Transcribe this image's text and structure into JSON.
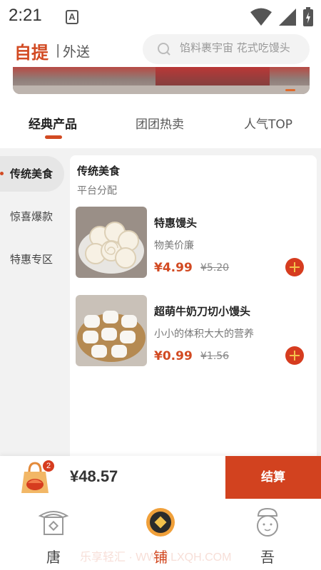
{
  "status_bar": {
    "time": "2:21",
    "notification_glyph": "A"
  },
  "header": {
    "mode_pickup": "自提",
    "mode_separator": "|",
    "mode_delivery": "外送",
    "search_placeholder": "馅料裹宇宙 花式吃馒头"
  },
  "tabs": [
    {
      "label": "经典产品",
      "active": true
    },
    {
      "label": "团团热卖",
      "active": false
    },
    {
      "label": "人气TOP",
      "active": false
    }
  ],
  "sidebar": {
    "items": [
      {
        "label": "传统美食",
        "active": true
      },
      {
        "label": "惊喜爆款",
        "active": false
      },
      {
        "label": "特惠专区",
        "active": false
      }
    ]
  },
  "category": {
    "title": "传统美食",
    "subtitle": "平台分配"
  },
  "products": [
    {
      "name": "特惠馒头",
      "desc": "物美价廉",
      "price": "¥4.99",
      "old_price": "¥5.20"
    },
    {
      "name": "超萌牛奶刀切小馒头",
      "desc": "小小的体积大大的营养",
      "price": "¥0.99",
      "old_price": "¥1.56"
    }
  ],
  "cart": {
    "badge": "2",
    "total": "¥48.57",
    "checkout_label": "结算"
  },
  "bottom_nav": [
    {
      "label": "唐",
      "icon": "pagoda-icon",
      "active": false
    },
    {
      "label": "铺",
      "icon": "coin-shop-icon",
      "active": true
    },
    {
      "label": "吾",
      "icon": "chef-avatar-icon",
      "active": false
    }
  ],
  "watermark": "乐享轻汇 · WWW.LXQH.COM",
  "colors": {
    "accent": "#d24a22",
    "checkout": "#d2421f",
    "add_button": "#d63c1f"
  }
}
